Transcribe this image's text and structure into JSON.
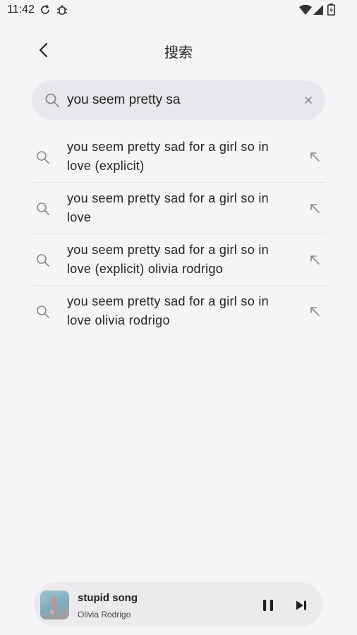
{
  "status_bar": {
    "time": "11:42",
    "icons": [
      "sync-icon",
      "bug-icon",
      "wifi-icon",
      "signal-icon",
      "battery-icon"
    ]
  },
  "header": {
    "title": "搜索",
    "back_icon": "chevron-left-icon"
  },
  "search": {
    "value": "you seem pretty sa",
    "icon": "search-icon",
    "clear_icon": "close-icon"
  },
  "suggestions": [
    {
      "text": "you seem pretty sad for a girl so in love (explicit)"
    },
    {
      "text": "you seem pretty sad for a girl so in love"
    },
    {
      "text": "you seem pretty sad for a girl so in love (explicit) olivia rodrigo"
    },
    {
      "text": "you seem pretty sad for a girl so in love olivia rodrigo"
    }
  ],
  "player": {
    "title": "stupid song",
    "artist": "Olivia Rodrigo",
    "pause_icon": "pause-icon",
    "next_icon": "skip-next-icon"
  },
  "colors": {
    "background": "#f5f5f7",
    "search_bg": "#e8e8ec",
    "player_bg": "#ebebee",
    "icon_gray": "#8a8a8a"
  }
}
